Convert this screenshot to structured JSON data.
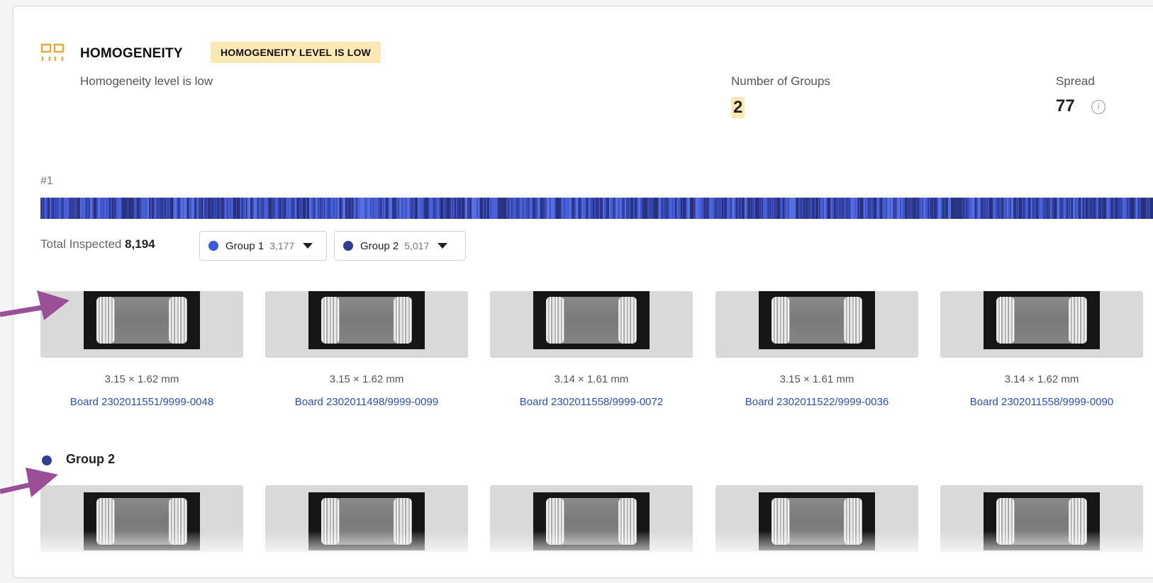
{
  "header": {
    "title": "HOMOGENEITY",
    "badge": "HOMOGENEITY LEVEL IS LOW",
    "subtitle": "Homogeneity level is low"
  },
  "metrics": {
    "groups_label": "Number of Groups",
    "groups_value": "2",
    "spread_label": "Spread",
    "spread_value": "77"
  },
  "row_number": "#1",
  "summary": {
    "total_label": "Total Inspected",
    "total_value": "8,194",
    "groups": [
      {
        "label": "Group 1",
        "count": "3,177",
        "color": "#3d5bd6"
      },
      {
        "label": "Group 2",
        "count": "5,017",
        "color": "#2e3f8f"
      }
    ]
  },
  "group1_items": [
    {
      "dims": "3.15 × 1.62 mm",
      "board": "Board 2302011551/9999-0048"
    },
    {
      "dims": "3.15 × 1.62 mm",
      "board": "Board 2302011498/9999-0099"
    },
    {
      "dims": "3.14 × 1.61 mm",
      "board": "Board 2302011558/9999-0072"
    },
    {
      "dims": "3.15 × 1.61 mm",
      "board": "Board 2302011522/9999-0036"
    },
    {
      "dims": "3.14 × 1.62 mm",
      "board": "Board 2302011558/9999-0090"
    }
  ],
  "group2": {
    "label": "Group 2"
  },
  "colors": {
    "accent_yellow": "#fbe9b5",
    "icon_gold": "#e3a93a",
    "link_blue": "#2c4fb5",
    "arrow_purple": "#9b4f96",
    "barcode_blue": "#3d4fc4"
  }
}
